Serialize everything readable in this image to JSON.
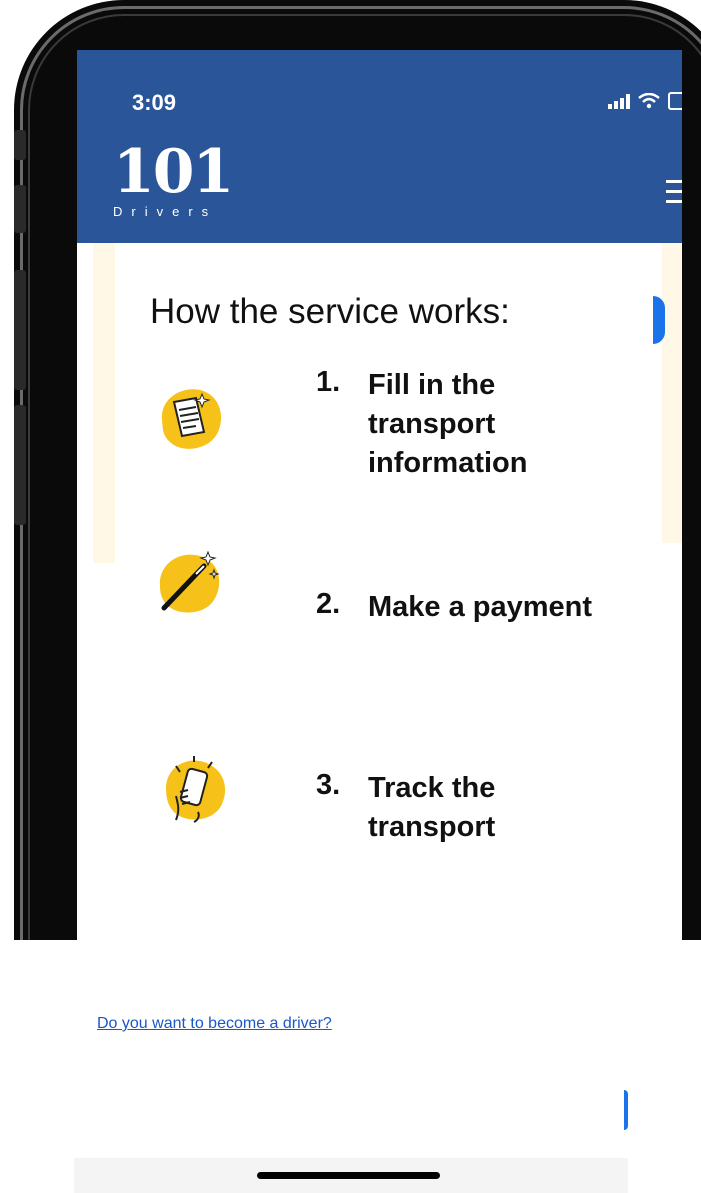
{
  "status_bar": {
    "time": "3:09"
  },
  "header": {
    "logo_number": "101",
    "logo_subtitle": "Drivers",
    "menu_icon": "hamburger-menu-icon",
    "background": "#2b5599"
  },
  "content": {
    "title": "How the service works:",
    "steps": [
      {
        "number": "1.",
        "lines": [
          "Fill in the",
          "transport",
          "information"
        ],
        "icon": "document-icon"
      },
      {
        "number": "2.",
        "lines": [
          "Make a payment"
        ],
        "icon": "magic-wand-icon"
      },
      {
        "number": "3.",
        "lines": [
          "Track the",
          "transport"
        ],
        "icon": "phone-in-hand-icon"
      }
    ]
  },
  "footer": {
    "driver_link": "Do you want to become a driver?"
  },
  "colors": {
    "accent_yellow": "#f6c21a",
    "link_blue": "#1a57c9",
    "button_blue": "#1a73e8"
  }
}
